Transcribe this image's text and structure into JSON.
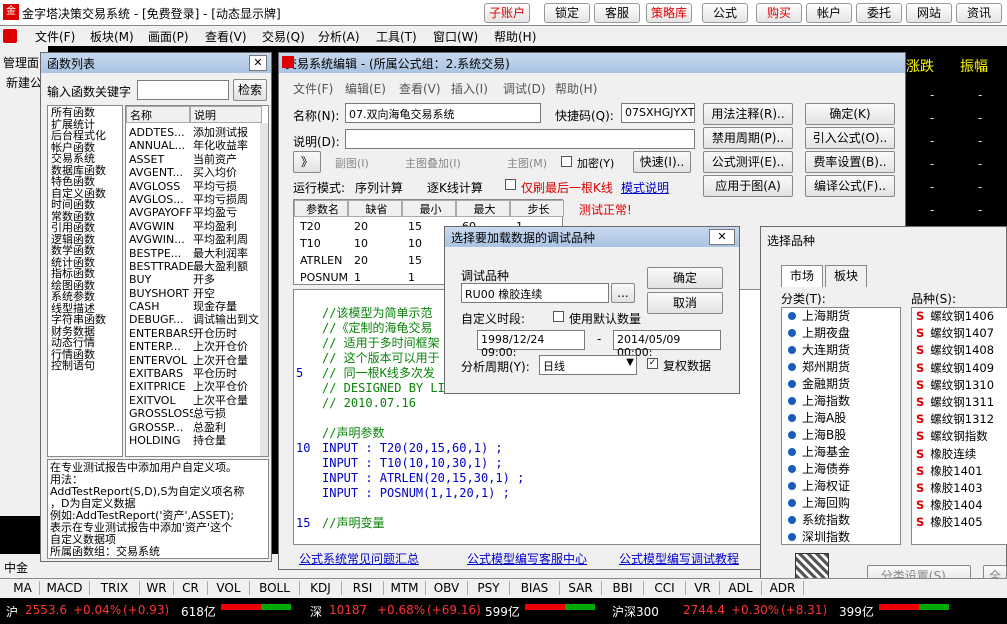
{
  "app": {
    "title": "金字塔决策交易系统 - [免费登录] - [动态显示牌]"
  },
  "topbuttons": [
    {
      "label": "子账户",
      "red": true
    },
    {
      "label": "锁定"
    },
    {
      "label": "客服"
    },
    {
      "label": "策略库",
      "red": true
    },
    {
      "label": "公式"
    },
    {
      "label": "购买",
      "red": true
    },
    {
      "label": "帐户"
    },
    {
      "label": "委托"
    },
    {
      "label": "网站"
    },
    {
      "label": "资讯"
    }
  ],
  "menu": [
    "文件(F)",
    "板块(M)",
    "画面(P)",
    "查看(V)",
    "交易(Q)",
    "分析(A)",
    "工具(T)",
    "窗口(W)",
    "帮助(H)"
  ],
  "bg": {
    "left_label": "管理面",
    "left_label2": "新建公",
    "right_col1": "涨跌",
    "right_col2": "振幅",
    "dashes": [
      "-",
      "-",
      "-",
      "-",
      "-",
      "-",
      "-",
      "-",
      "-",
      "-",
      "-",
      "-",
      "-",
      "-",
      "-",
      "-",
      "-",
      "-",
      "-",
      "-",
      "-",
      "-",
      "-",
      "-",
      "-",
      "-",
      "-",
      "-",
      "-",
      "-"
    ],
    "gong": "公",
    "zhongjin": "中金"
  },
  "funclist": {
    "title": "函数列表",
    "search_label": "输入函数关键字",
    "search_btn": "检索",
    "categories": [
      "所有函数",
      "扩展统计",
      "后台程式化",
      "帐户函数",
      "交易系统",
      "数据库函数",
      "特色函数",
      "自定义函数",
      "时间函数",
      "常数函数",
      "引用函数",
      "逻辑函数",
      "数学函数",
      "统计函数",
      "指标函数",
      "绘图函数",
      "系统参数",
      "线型描述",
      "字符串函数",
      "财务数据",
      "动态行情",
      "行情函数",
      "控制语句"
    ],
    "col_name": "名称",
    "col_desc": "说明",
    "funcs": [
      [
        "ADDTES...",
        "添加测试报"
      ],
      [
        "ANNUAL...",
        "年化收益率"
      ],
      [
        "ASSET",
        "当前资产"
      ],
      [
        "AVGENT...",
        "买入均价"
      ],
      [
        "AVGLOSS",
        "平均亏损"
      ],
      [
        "AVGLOS...",
        "平均亏损周"
      ],
      [
        "AVGPAYOFF",
        "平均盈亏"
      ],
      [
        "AVGWIN",
        "平均盈利"
      ],
      [
        "AVGWIN...",
        "平均盈利周"
      ],
      [
        "BESTPE...",
        "最大利润率"
      ],
      [
        "BESTTRADE",
        "最大盈利额"
      ],
      [
        "BUY",
        "开多"
      ],
      [
        "BUYSHORT",
        "开空"
      ],
      [
        "CASH",
        "现金存量"
      ],
      [
        "DEBUGF...",
        "调试输出到文"
      ],
      [
        "ENTERBARS",
        "开仓历时"
      ],
      [
        "ENTERP...",
        "上次开仓价"
      ],
      [
        "ENTERVOL",
        "上次开仓量"
      ],
      [
        "EXITBARS",
        "平仓历时"
      ],
      [
        "EXITPRICE",
        "上次平仓价"
      ],
      [
        "EXITVOL",
        "上次平仓量"
      ],
      [
        "GROSSLOSS",
        "总亏损"
      ],
      [
        "GROSSP...",
        "总盈利"
      ],
      [
        "HOLDING",
        "持仓量"
      ]
    ],
    "help": [
      "在专业测试报告中添加用户自定义项。",
      "用法：",
      "AddTestReport(S,D),S为自定义项名称",
      "，D为自定义数据",
      "例如:AddTestReport('资产',ASSET);",
      "表示在专业测试报告中添加'资产'这个",
      "自定义数据项",
      "所属函数组：交易系统"
    ]
  },
  "editor": {
    "title": "交易系统编辑 - (所属公式组：2.系统交易)",
    "menu": [
      "文件(F)",
      "编辑(E)",
      "查看(V)",
      "插入(I)",
      "调试(D)",
      "帮助(H)"
    ],
    "name_label": "名称(N):",
    "name_value": "07.双向海龟交易系统",
    "code_label": "快捷码(Q):",
    "code_value": "07SXHGJYXT",
    "desc_label": "说明(D):",
    "btn_usage": "用法注释(R)..",
    "btn_ok": "确定(K)",
    "btn_disable": "禁用周期(P)..",
    "btn_import": "引入公式(O)..",
    "btn_test": "公式测评(E)..",
    "btn_fee": "费率设置(B)..",
    "btn_apply": "应用于图(A)",
    "btn_compile": "编译公式(F)..",
    "btn_quick": "快速(I)..",
    "arrow": "》",
    "radio_sub": "副图(I)",
    "radio_overlay": "主图叠加(I)",
    "radio_main": "主图(M)",
    "chk_encrypt": "加密(Y)",
    "run_label": "运行模式:",
    "run_seq": "序列计算",
    "run_bar": "逐K线计算",
    "run_last": "仅刷最后一根K线",
    "mode_link": "模式说明",
    "status": "测试正常!",
    "param_headers": [
      "参数名",
      "缺省",
      "最小",
      "最大",
      "步长"
    ],
    "params": [
      [
        "T20",
        "20",
        "15",
        "60",
        "1"
      ],
      [
        "T10",
        "10",
        "10",
        "30",
        "1"
      ],
      [
        "ATRLEN",
        "20",
        "15",
        "30",
        "1"
      ],
      [
        "POSNUM",
        "1",
        "1",
        "20",
        "1"
      ]
    ],
    "line_numbers": [
      "",
      "",
      "",
      "",
      "5",
      "",
      "",
      "",
      "",
      "10",
      "",
      "",
      "",
      "",
      "15"
    ],
    "code": [
      "//该模型为简单示范",
      "//《定制的海龟交易",
      "// 适用于多时间框架",
      "// 这个版本可以用于",
      "// 同一根K线多次发",
      "// DESIGNED BY LIN",
      "// 2010.07.16",
      "",
      "//声明参数",
      "INPUT : T20(20,15,60,1) ;",
      "INPUT : T10(10,10,30,1) ;",
      "INPUT : ATRLEN(20,15,30,1) ;",
      "INPUT : POSNUM(1,1,20,1) ;",
      "",
      "//声明变量"
    ],
    "side_text1": "实际",
    "side_text2": "空",
    "links": [
      "公式系统常见问题汇总",
      "公式模型编写客服中心",
      "公式模型编写调试教程"
    ]
  },
  "debug": {
    "title": "选择要加载数据的调试品种",
    "variety_label": "调试品种",
    "variety_value": "RU00 橡胶连续",
    "more": "...",
    "ok": "确定",
    "cancel": "取消",
    "period_label": "自定义时段:",
    "use_default": "使用默认数量",
    "from": "1998/12/24 09:00:",
    "dash": "-",
    "to": "2014/05/09 00:00:",
    "cycle_label": "分析周期(Y):",
    "cycle_value": "日线",
    "restore": "复权数据"
  },
  "selector": {
    "title": "选择品种",
    "tabs": [
      "市场",
      "板块"
    ],
    "cat_label": "分类(T):",
    "prod_label": "品种(S):",
    "categories": [
      "上海期货",
      "上期夜盘",
      "大连期货",
      "郑州期货",
      "金融期货",
      "上海指数",
      "上海A股",
      "上海B股",
      "上海基金",
      "上海债券",
      "上海权证",
      "上海回购",
      "系统指数",
      "深圳指数"
    ],
    "products": [
      "螺纹钢1406",
      "螺纹钢1407",
      "螺纹钢1408",
      "螺纹钢1409",
      "螺纹钢1310",
      "螺纹钢1311",
      "螺纹钢1312",
      "螺纹钢指数",
      "橡胶连续",
      "橡胶1401",
      "橡胶1403",
      "橡胶1404",
      "橡胶1405"
    ],
    "prod_prefix": "S",
    "btn_cat": "分类设置(S)...",
    "btn_all": "全"
  },
  "indicators": [
    "MA",
    "MACD",
    "TRIX",
    "WR",
    "CR",
    "VOL",
    "BOLL",
    "KDJ",
    "RSI",
    "MTM",
    "OBV",
    "PSY",
    "BIAS",
    "SAR",
    "BBI",
    "CCI",
    "VR",
    "ADL",
    "ADR"
  ],
  "ticker": [
    {
      "name": "沪",
      "price": "2553.6",
      "pct": "+0.04%",
      "chg": "(+0.93)",
      "amt": "618亿"
    },
    {
      "name": "深",
      "price": "10187",
      "pct": "+0.68%",
      "chg": "(+69.16)",
      "amt": "599亿"
    },
    {
      "name": "沪深300",
      "price": "2744.4",
      "pct": "+0.30%",
      "chg": "(+8.31)",
      "amt": "399亿"
    }
  ]
}
